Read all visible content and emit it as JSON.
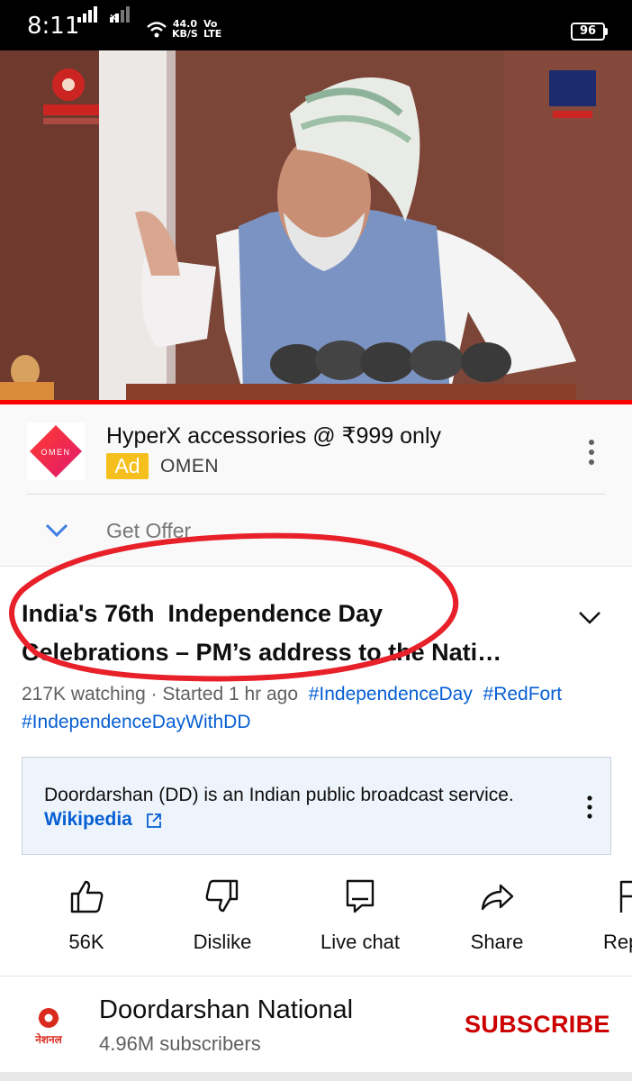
{
  "status_bar": {
    "time": "8:11",
    "net_speed_value": "44.0",
    "net_speed_unit": "KB/S",
    "volte_top": "Vo",
    "volte_bottom": "LTE",
    "battery": "96"
  },
  "video": {
    "progress_fraction": 1.0
  },
  "ad": {
    "title": "HyperX accessories @ ₹999 only",
    "badge": "Ad",
    "advertiser": "OMEN",
    "cta": "Get Offer",
    "logo_text": "OMEN"
  },
  "video_info": {
    "title_line1": "India's 76th  Independence Day",
    "title_line2": "Celebrations – PM’s address to the Nati…",
    "watching": "217K watching · Started 1 hr ago",
    "hashtags": [
      "#IndependenceDay",
      "#RedFort",
      "#IndependenceDayWithDD"
    ]
  },
  "info_panel": {
    "text": "Doordarshan (DD) is an Indian public broadcast service.",
    "link": "Wikipedia"
  },
  "actions": [
    {
      "label": "56K",
      "icon": "thumbs-up-icon"
    },
    {
      "label": "Dislike",
      "icon": "thumbs-down-icon"
    },
    {
      "label": "Live chat",
      "icon": "chat-icon"
    },
    {
      "label": "Share",
      "icon": "share-icon"
    },
    {
      "label": "Rep",
      "icon": "flag-icon"
    }
  ],
  "channel": {
    "name": "Doordarshan National",
    "subscribers": "4.96M subscribers",
    "subscribe_label": "SUBSCRIBE",
    "avatar_text": "नेशनल"
  },
  "colors": {
    "accent_red": "#ff0000",
    "subscribe_red": "#cc0000",
    "link_blue": "#065fd4",
    "ad_badge_yellow": "#f5c01e",
    "annotation_red": "#e8202a"
  }
}
